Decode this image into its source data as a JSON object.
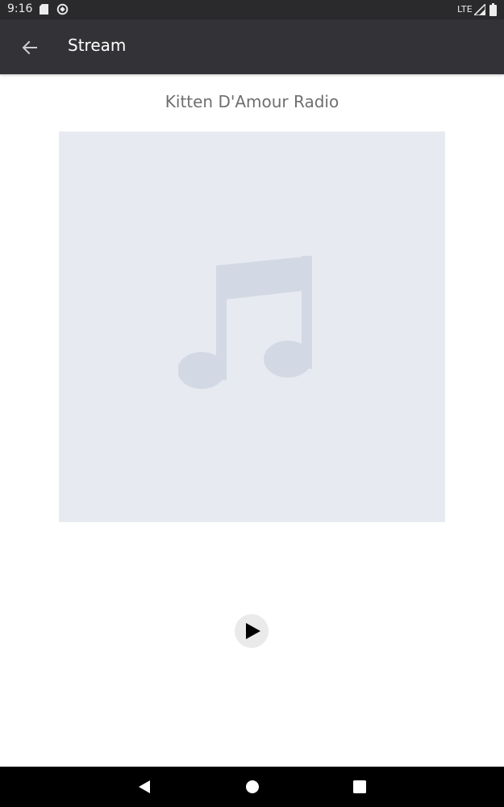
{
  "status_bar": {
    "time": "9:16",
    "network": "LTE",
    "icons": [
      "sd-card-icon",
      "sync-icon",
      "signal-icon",
      "battery-icon"
    ]
  },
  "app_bar": {
    "title": "Stream",
    "back_icon": "arrow-back-icon"
  },
  "player": {
    "station_name": "Kitten D'Amour Radio",
    "artwork_icon": "music-note-icon",
    "play_icon": "play-icon"
  },
  "nav_bar": {
    "icons": [
      "nav-back-icon",
      "nav-home-icon",
      "nav-recents-icon"
    ]
  },
  "colors": {
    "status_bar_bg": "#2a2a2c",
    "app_bar_bg": "#333236",
    "artwork_bg": "#e8eaf1",
    "music_note": "#d3d9e4",
    "station_text": "#6f6f6f",
    "play_button_bg": "#eaeaea"
  }
}
